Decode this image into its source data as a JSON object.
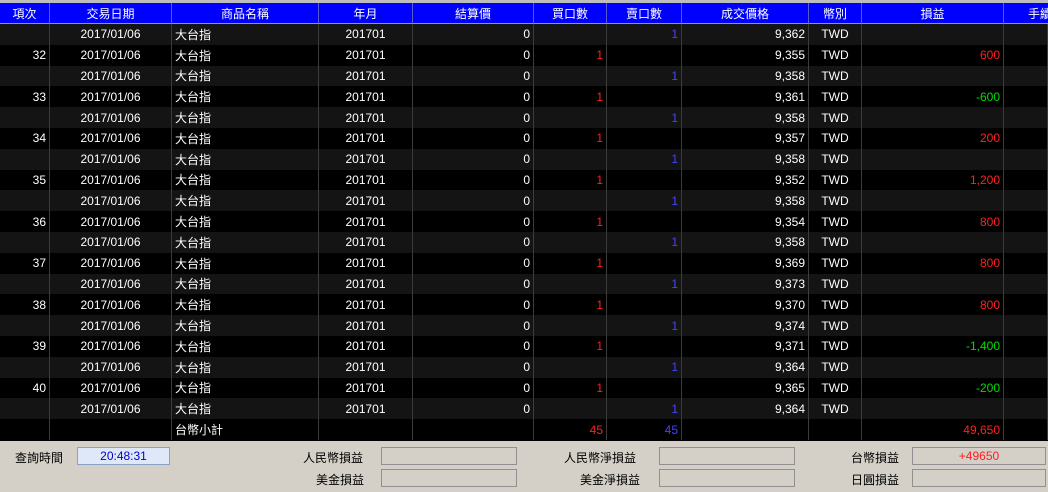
{
  "columns": [
    "項次",
    "交易日期",
    "商品名稱",
    "年月",
    "結算價",
    "買口數",
    "賣口數",
    "成交價格",
    "幣別",
    "損益",
    "手續費"
  ],
  "rows": [
    {
      "idx": "",
      "date": "2017/01/06",
      "product": "大台指",
      "ym": "201701",
      "settle": "0",
      "buy": "",
      "sell": "1",
      "price": "9,362",
      "cur": "TWD",
      "pnl": "",
      "pnl_color": ""
    },
    {
      "idx": "32",
      "date": "2017/01/06",
      "product": "大台指",
      "ym": "201701",
      "settle": "0",
      "buy": "1",
      "sell": "",
      "price": "9,355",
      "cur": "TWD",
      "pnl": "600",
      "pnl_color": "red"
    },
    {
      "idx": "",
      "date": "2017/01/06",
      "product": "大台指",
      "ym": "201701",
      "settle": "0",
      "buy": "",
      "sell": "1",
      "price": "9,358",
      "cur": "TWD",
      "pnl": "",
      "pnl_color": ""
    },
    {
      "idx": "33",
      "date": "2017/01/06",
      "product": "大台指",
      "ym": "201701",
      "settle": "0",
      "buy": "1",
      "sell": "",
      "price": "9,361",
      "cur": "TWD",
      "pnl": "-600",
      "pnl_color": "green"
    },
    {
      "idx": "",
      "date": "2017/01/06",
      "product": "大台指",
      "ym": "201701",
      "settle": "0",
      "buy": "",
      "sell": "1",
      "price": "9,358",
      "cur": "TWD",
      "pnl": "",
      "pnl_color": ""
    },
    {
      "idx": "34",
      "date": "2017/01/06",
      "product": "大台指",
      "ym": "201701",
      "settle": "0",
      "buy": "1",
      "sell": "",
      "price": "9,357",
      "cur": "TWD",
      "pnl": "200",
      "pnl_color": "red"
    },
    {
      "idx": "",
      "date": "2017/01/06",
      "product": "大台指",
      "ym": "201701",
      "settle": "0",
      "buy": "",
      "sell": "1",
      "price": "9,358",
      "cur": "TWD",
      "pnl": "",
      "pnl_color": ""
    },
    {
      "idx": "35",
      "date": "2017/01/06",
      "product": "大台指",
      "ym": "201701",
      "settle": "0",
      "buy": "1",
      "sell": "",
      "price": "9,352",
      "cur": "TWD",
      "pnl": "1,200",
      "pnl_color": "red"
    },
    {
      "idx": "",
      "date": "2017/01/06",
      "product": "大台指",
      "ym": "201701",
      "settle": "0",
      "buy": "",
      "sell": "1",
      "price": "9,358",
      "cur": "TWD",
      "pnl": "",
      "pnl_color": ""
    },
    {
      "idx": "36",
      "date": "2017/01/06",
      "product": "大台指",
      "ym": "201701",
      "settle": "0",
      "buy": "1",
      "sell": "",
      "price": "9,354",
      "cur": "TWD",
      "pnl": "800",
      "pnl_color": "red"
    },
    {
      "idx": "",
      "date": "2017/01/06",
      "product": "大台指",
      "ym": "201701",
      "settle": "0",
      "buy": "",
      "sell": "1",
      "price": "9,358",
      "cur": "TWD",
      "pnl": "",
      "pnl_color": ""
    },
    {
      "idx": "37",
      "date": "2017/01/06",
      "product": "大台指",
      "ym": "201701",
      "settle": "0",
      "buy": "1",
      "sell": "",
      "price": "9,369",
      "cur": "TWD",
      "pnl": "800",
      "pnl_color": "red"
    },
    {
      "idx": "",
      "date": "2017/01/06",
      "product": "大台指",
      "ym": "201701",
      "settle": "0",
      "buy": "",
      "sell": "1",
      "price": "9,373",
      "cur": "TWD",
      "pnl": "",
      "pnl_color": ""
    },
    {
      "idx": "38",
      "date": "2017/01/06",
      "product": "大台指",
      "ym": "201701",
      "settle": "0",
      "buy": "1",
      "sell": "",
      "price": "9,370",
      "cur": "TWD",
      "pnl": "800",
      "pnl_color": "red"
    },
    {
      "idx": "",
      "date": "2017/01/06",
      "product": "大台指",
      "ym": "201701",
      "settle": "0",
      "buy": "",
      "sell": "1",
      "price": "9,374",
      "cur": "TWD",
      "pnl": "",
      "pnl_color": ""
    },
    {
      "idx": "39",
      "date": "2017/01/06",
      "product": "大台指",
      "ym": "201701",
      "settle": "0",
      "buy": "1",
      "sell": "",
      "price": "9,371",
      "cur": "TWD",
      "pnl": "-1,400",
      "pnl_color": "green"
    },
    {
      "idx": "",
      "date": "2017/01/06",
      "product": "大台指",
      "ym": "201701",
      "settle": "0",
      "buy": "",
      "sell": "1",
      "price": "9,364",
      "cur": "TWD",
      "pnl": "",
      "pnl_color": ""
    },
    {
      "idx": "40",
      "date": "2017/01/06",
      "product": "大台指",
      "ym": "201701",
      "settle": "0",
      "buy": "1",
      "sell": "",
      "price": "9,365",
      "cur": "TWD",
      "pnl": "-200",
      "pnl_color": "green"
    },
    {
      "idx": "",
      "date": "2017/01/06",
      "product": "大台指",
      "ym": "201701",
      "settle": "0",
      "buy": "",
      "sell": "1",
      "price": "9,364",
      "cur": "TWD",
      "pnl": "",
      "pnl_color": ""
    }
  ],
  "subtotal": {
    "label": "台幣小計",
    "buy": "45",
    "sell": "45",
    "pnl": "49,650"
  },
  "footer": {
    "query_time_label": "查詢時間",
    "query_time_value": "20:48:31",
    "rmb_pnl_label": "人民幣損益",
    "rmb_pnl_value": "",
    "usd_pnl_label": "美金損益",
    "usd_pnl_value": "",
    "rmb_net_label": "人民幣淨損益",
    "rmb_net_value": "",
    "usd_net_label": "美金淨損益",
    "usd_net_value": "",
    "twd_pnl_label": "台幣損益",
    "twd_pnl_value": "+49650",
    "jpy_pnl_label": "日圓損益",
    "jpy_pnl_value": ""
  },
  "colors": {
    "header_bg": "#0000ff",
    "positive": "#ff2020",
    "negative": "#00dd00",
    "sell_qty": "#4444ff",
    "footer_bg": "#d4d0c8"
  }
}
